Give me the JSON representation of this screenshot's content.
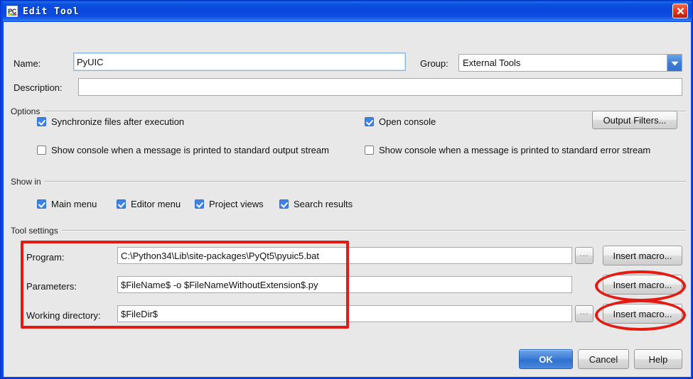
{
  "window": {
    "title": "Edit Tool",
    "app_icon": "pycharm-icon",
    "close_label": "close-icon"
  },
  "form": {
    "name_label": "Name:",
    "name_value": "PyUIC",
    "name_placeholder": "",
    "group_label": "Group:",
    "group_value": "External Tools",
    "description_label": "Description:",
    "description_value": "",
    "description_placeholder": ""
  },
  "options": {
    "title": "Options",
    "checkboxes": [
      {
        "label": "Synchronize files after execution",
        "checked": true
      },
      {
        "label": "Open console",
        "checked": true
      },
      {
        "label": "Show console when a message is printed to standard output stream",
        "checked": false
      },
      {
        "label": "Show console when a message is printed to standard error stream",
        "checked": false
      }
    ],
    "output_filters_label": "Output Filters..."
  },
  "show_in": {
    "title": "Show in",
    "checkboxes": [
      {
        "label": "Main menu",
        "checked": true
      },
      {
        "label": "Editor menu",
        "checked": true
      },
      {
        "label": "Project views",
        "checked": true
      },
      {
        "label": "Search results",
        "checked": true
      }
    ]
  },
  "tool_settings": {
    "title": "Tool settings",
    "rows": [
      {
        "label": "Program:",
        "value": "C:\\Python34\\Lib\\site-packages\\PyQt5\\pyuic5.bat",
        "browse_label": "...",
        "has_browse": true,
        "macro_label": "Insert macro..."
      },
      {
        "label": "Parameters:",
        "value": "$FileName$ -o $FileNameWithoutExtension$.py",
        "browse_label": "",
        "has_browse": false,
        "macro_label": "Insert macro..."
      },
      {
        "label": "Working directory:",
        "value": "$FileDir$",
        "browse_label": "...",
        "has_browse": true,
        "macro_label": "Insert macro..."
      }
    ]
  },
  "footer": {
    "ok_label": "OK",
    "cancel_label": "Cancel",
    "help_label": "Help"
  },
  "annotations": {
    "highlight_color": "#e21b13",
    "rect_target": "tool-settings-fields",
    "ellipse_targets": [
      "insert-macro-parameters",
      "insert-macro-working-directory"
    ]
  },
  "colors": {
    "title_bar": "#0a47dd",
    "dialog_bg": "#e8e8e8",
    "accent": "#3d82e4",
    "annotation": "#e21b13"
  }
}
